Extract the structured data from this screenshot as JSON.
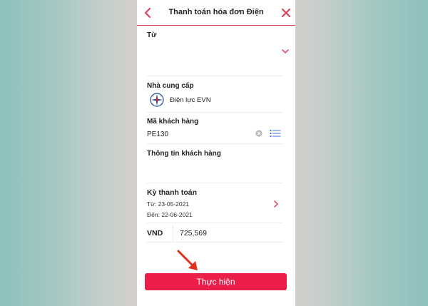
{
  "header": {
    "title": "Thanh toán hóa đơn Điện"
  },
  "from": {
    "label": "Từ"
  },
  "provider": {
    "label": "Nhà cung cấp",
    "name": "Điện lực EVN"
  },
  "customer_code": {
    "label": "Mã khách hàng",
    "value": "PE130"
  },
  "customer_info": {
    "label": "Thông tin khách hàng"
  },
  "billing_period": {
    "label": "Kỳ thanh toán",
    "from_text": "Từ: 23-05-2021",
    "to_text": "Đến: 22-06-2021"
  },
  "amount": {
    "currency": "VND",
    "value": "725,569"
  },
  "submit": {
    "label": "Thực hiện"
  },
  "colors": {
    "accent": "#ea1e48",
    "header_line": "#e23a55",
    "hint_arrow": "#e0321f"
  },
  "icons": {
    "back": "chevron-left-icon",
    "close": "close-icon",
    "from_dropdown": "chevron-down-icon",
    "provider_logo": "evn-logo",
    "clear": "clear-icon",
    "contact_list": "list-icon",
    "period_next": "chevron-right-icon",
    "hint": "arrow-icon"
  }
}
